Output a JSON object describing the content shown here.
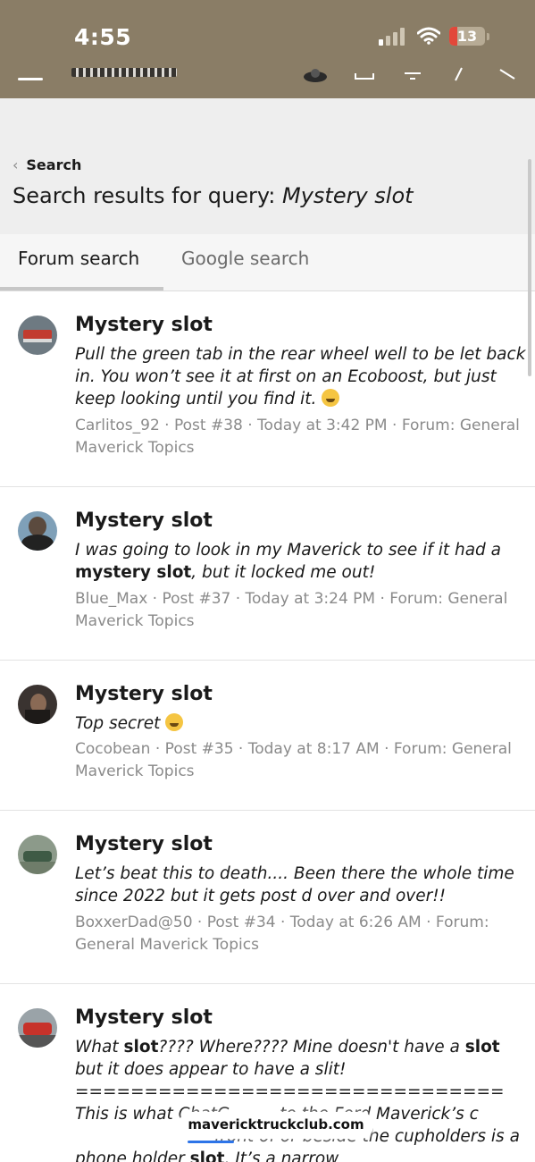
{
  "status_bar": {
    "time": "4:55",
    "battery_level": "13",
    "colors": {
      "bar_background": "#8a7d66",
      "battery_low": "#e2483a"
    }
  },
  "header": {
    "icons": [
      "menu-icon",
      "avatar-icon",
      "inbox-icon",
      "bell-icon",
      "compose-icon",
      "search-icon"
    ]
  },
  "breadcrumb": {
    "label": "Search"
  },
  "page": {
    "title_prefix": "Search results for query: ",
    "title_query": "Mystery slot"
  },
  "tabs": [
    {
      "label": "Forum search",
      "active": true
    },
    {
      "label": "Google search",
      "active": false
    }
  ],
  "results": [
    {
      "title": "Mystery slot",
      "snippet": "Pull the green tab in the rear wheel well to be let back in. You won’t see it at first on an Ecoboost, but just keep looking until you find it.",
      "meta": "Carlitos_92 · Post #38 · Today at 3:42 PM · Forum: General Maverick Topics"
    },
    {
      "title": "Mystery slot",
      "snippet_pre": "I was going to look in my Maverick to see if it had a ",
      "snippet_bold": "mystery slot",
      "snippet_post": ", but it locked me out!",
      "meta": "Blue_Max · Post #37 · Today at 3:24 PM · Forum: General Maverick Topics"
    },
    {
      "title": "Mystery slot",
      "snippet": "Top secret",
      "meta": "Cocobean · Post #35 · Today at 8:17 AM · Forum: General Maverick Topics"
    },
    {
      "title": "Mystery slot",
      "snippet": "Let’s beat this to death.... Been there the whole time since 2022 but it gets post d over and over!!",
      "meta": "BoxxerDad@50 · Post #34 · Today at 6:26 AM · Forum: General Maverick Topics"
    },
    {
      "title": "Mystery slot",
      "s1": "What ",
      "s2": "slot",
      "s3": "???? Where???? Mine doesn't have a ",
      "s4": "slot",
      "s5": " but it does appear to have a slit! ",
      "s6": "=============================== This is what ChatG",
      "s7": " to the Ford Maverick’s c",
      "s8": " front of or beside the cupholders is a phone holder ",
      "s9": "slot",
      "s10": ". It’s a narrow"
    }
  ],
  "url_bar": {
    "url": "mavericktruckclub.com"
  }
}
